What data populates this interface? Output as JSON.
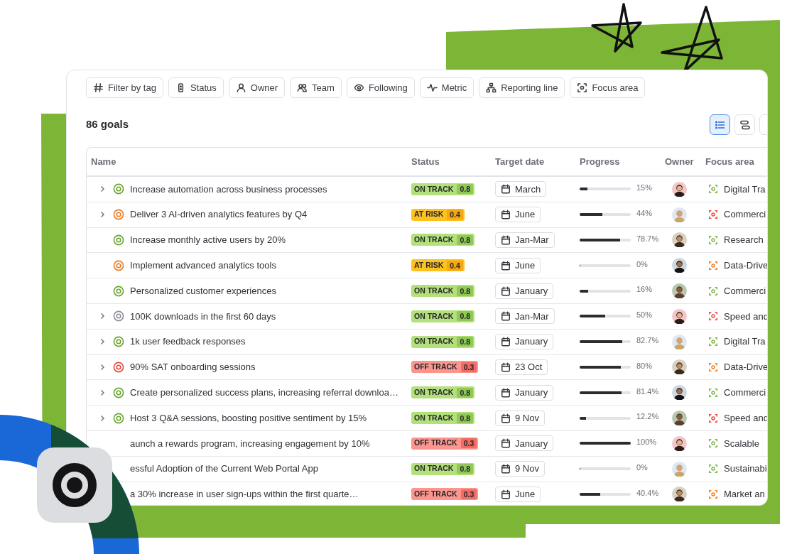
{
  "filters": [
    {
      "kind": "hash",
      "label": "Filter by tag"
    },
    {
      "kind": "status",
      "label": "Status"
    },
    {
      "kind": "person",
      "label": "Owner"
    },
    {
      "kind": "team",
      "label": "Team"
    },
    {
      "kind": "eye",
      "label": "Following"
    },
    {
      "kind": "pulse",
      "label": "Metric"
    },
    {
      "kind": "hierarchy",
      "label": "Reporting line"
    },
    {
      "kind": "focus",
      "label": "Focus area"
    }
  ],
  "goal_count": "86 goals",
  "view_buttons": [
    {
      "kind": "list",
      "selected": true
    },
    {
      "kind": "timeline",
      "selected": false
    }
  ],
  "table": {
    "columns": [
      "Name",
      "Status",
      "Target date",
      "Progress",
      "Owner",
      "Focus area"
    ],
    "rows": [
      {
        "expandable": true,
        "target_icon": {
          "shown": true,
          "color": "#6aa531"
        },
        "name": "Increase automation across business processes",
        "status": {
          "kind": "on_track",
          "label": "ON TRACK",
          "score": "0.8"
        },
        "date": "March",
        "level": 0.15,
        "percent": "15%",
        "focus_area": {
          "color": "#7cb342",
          "label": "Digital Tra"
        }
      },
      {
        "expandable": true,
        "target_icon": {
          "shown": true,
          "color": "#ea7a22"
        },
        "name": "Deliver 3 AI-driven analytics features by Q4",
        "status": {
          "kind": "at_risk",
          "label": "AT RISK",
          "score": "0.4"
        },
        "date": "June",
        "level": 0.44,
        "percent": "44%",
        "focus_area": {
          "color": "#e5483c",
          "label": "Commerci"
        }
      },
      {
        "expandable": false,
        "target_icon": {
          "shown": true,
          "color": "#6aa531"
        },
        "name": "Increase monthly active users by 20%",
        "status": {
          "kind": "on_track",
          "label": "ON TRACK",
          "score": "0.8"
        },
        "date": "Jan-Mar",
        "level": 0.787,
        "percent": "78.7%",
        "focus_area": {
          "color": "#7cb342",
          "label": "Research"
        }
      },
      {
        "expandable": false,
        "target_icon": {
          "shown": true,
          "color": "#ea7a22"
        },
        "name": "Implement advanced analytics tools",
        "status": {
          "kind": "at_risk",
          "label": "AT RISK",
          "score": "0.4"
        },
        "date": "June",
        "level": 0,
        "percent": "0%",
        "focus_area": {
          "color": "#f07c1a",
          "label": "Data-Drive"
        }
      },
      {
        "expandable": false,
        "target_icon": {
          "shown": true,
          "color": "#6aa531"
        },
        "name": "Personalized customer experiences",
        "status": {
          "kind": "on_track",
          "label": "ON TRACK",
          "score": "0.8"
        },
        "date": "January",
        "level": 0.16,
        "percent": "16%",
        "focus_area": {
          "color": "#7cb342",
          "label": "Commerci"
        }
      },
      {
        "expandable": true,
        "target_icon": {
          "shown": true,
          "color": "#8b8f9a"
        },
        "name": "100K downloads in the first 60 days",
        "status": {
          "kind": "on_track",
          "label": "ON TRACK",
          "score": "0.8"
        },
        "date": "Jan-Mar",
        "level": 0.5,
        "percent": "50%",
        "focus_area": {
          "color": "#e5483c",
          "label": "Speed and"
        }
      },
      {
        "expandable": true,
        "target_icon": {
          "shown": true,
          "color": "#6aa531"
        },
        "name": "1k user feedback responses",
        "status": {
          "kind": "on_track",
          "label": "ON TRACK",
          "score": "0.8"
        },
        "date": "January",
        "level": 0.827,
        "percent": "82.7%",
        "focus_area": {
          "color": "#7cb342",
          "label": "Digital Tra"
        }
      },
      {
        "expandable": true,
        "target_icon": {
          "shown": true,
          "color": "#e5483c"
        },
        "name": "90% SAT onboarding sessions",
        "status": {
          "kind": "off_track",
          "label": "OFF TRACK",
          "score": "0.3"
        },
        "date": "23 Oct",
        "level": 0.8,
        "percent": "80%",
        "focus_area": {
          "color": "#f07c1a",
          "label": "Data-Drive"
        }
      },
      {
        "expandable": true,
        "target_icon": {
          "shown": true,
          "color": "#6aa531"
        },
        "name": "Create personalized success plans, increasing referral downloa…",
        "status": {
          "kind": "on_track",
          "label": "ON TRACK",
          "score": "0.8"
        },
        "date": "January",
        "level": 0.814,
        "percent": "81.4%",
        "focus_area": {
          "color": "#7cb342",
          "label": "Commerci"
        }
      },
      {
        "expandable": true,
        "target_icon": {
          "shown": true,
          "color": "#6aa531"
        },
        "name": "Host 3 Q&A sessions, boosting positive sentiment by 15%",
        "status": {
          "kind": "on_track",
          "label": "ON TRACK",
          "score": "0.8"
        },
        "date": "9 Nov",
        "level": 0.122,
        "percent": "12.2%",
        "focus_area": {
          "color": "#e5483c",
          "label": "Speed and"
        }
      },
      {
        "name": "aunch a rewards program, increasing engagement by 10%",
        "status": {
          "kind": "off_track",
          "label": "OFF TRACK",
          "score": "0.3"
        },
        "date": "January",
        "level": 1,
        "percent": "100%",
        "focus_area": {
          "color": "#7cb342",
          "label": "Scalable"
        }
      },
      {
        "name": "essful Adoption of the Current Web Portal App",
        "status": {
          "kind": "on_track",
          "label": "ON TRACK",
          "score": "0.8"
        },
        "date": "9 Nov",
        "level": 0,
        "percent": "0%",
        "focus_area": {
          "color": "#7cb342",
          "label": "Sustainabi"
        }
      },
      {
        "name": "a 30% increase in user sign-ups within the first quarte…",
        "status": {
          "kind": "off_track",
          "label": "OFF TRACK",
          "score": "0.3"
        },
        "date": "June",
        "level": 0.404,
        "percent": "40.4%",
        "focus_area": {
          "color": "#f07c1a",
          "label": "Market an"
        }
      }
    ]
  }
}
